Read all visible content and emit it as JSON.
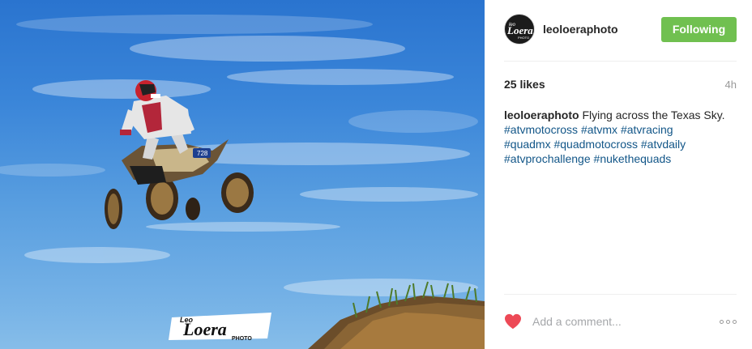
{
  "post": {
    "image_alt": "ATV rider jumping against blue sky",
    "watermark": {
      "small": "Leo",
      "main": "Loera",
      "sub": "PHOTO"
    },
    "avatar_text": {
      "small": "leo",
      "main": "Loera",
      "sub": "PHOTO"
    }
  },
  "header": {
    "username": "leoloeraphoto",
    "follow_label": "Following",
    "follow_color": "#70c050"
  },
  "stats": {
    "likes": "25 likes",
    "time": "4h"
  },
  "caption": {
    "username": "leoloeraphoto",
    "text": "Flying across the Texas Sky.",
    "hashtags": [
      "#atvmotocross",
      "#atvmx",
      "#atvracing",
      "#quadmx",
      "#quadmotocross",
      "#atvdaily",
      "#atvprochallenge",
      "#nukethequads"
    ]
  },
  "footer": {
    "comment_placeholder": "Add a comment...",
    "heart_icon": "heart-icon",
    "heart_color": "#ed4956",
    "more_icon": "more-options-icon"
  }
}
